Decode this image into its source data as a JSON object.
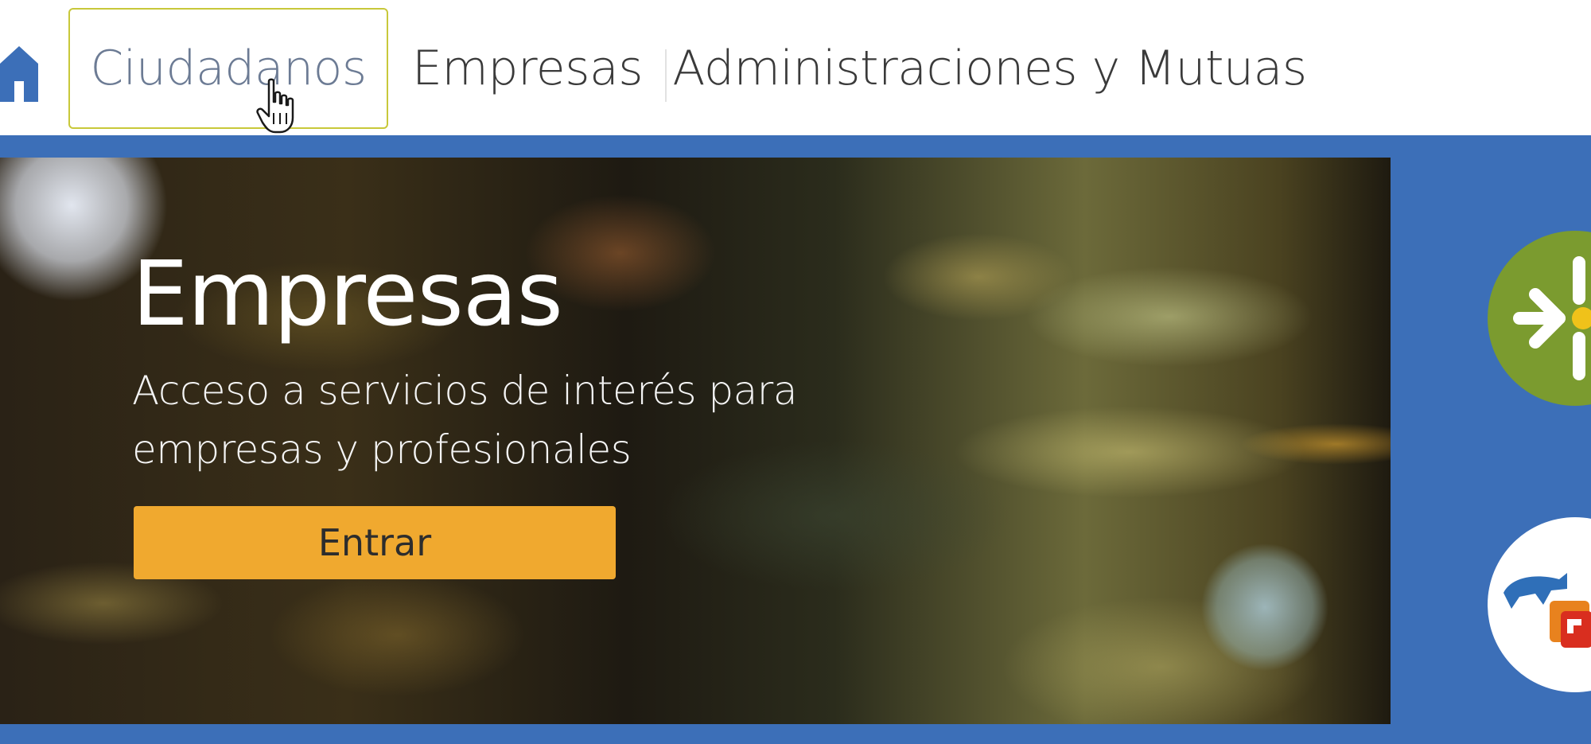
{
  "nav": {
    "items": [
      {
        "label": "Ciudadanos"
      },
      {
        "label": "Empresas"
      },
      {
        "label": "Administraciones y Mutuas"
      }
    ]
  },
  "hero": {
    "title": "Empresas",
    "subtitle_line1": "Acceso a servicios de interés para",
    "subtitle_line2": "empresas y profesionales",
    "button_label": "Entrar"
  },
  "colors": {
    "brand_blue": "#3c6fb8",
    "button_orange": "#f0a92f",
    "hover_border": "#c8c83a",
    "logo_green": "#7b9b2f"
  },
  "icons": [
    "home-icon",
    "hand-cursor-icon"
  ]
}
